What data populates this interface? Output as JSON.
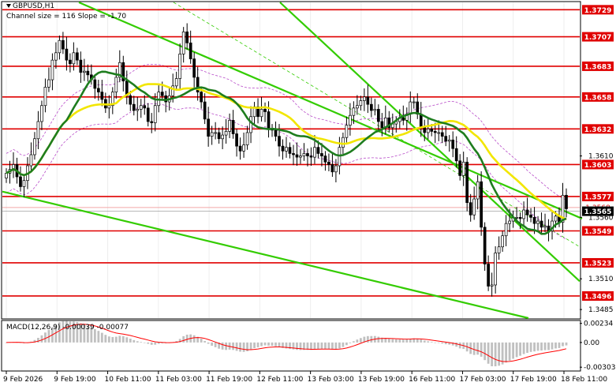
{
  "chart_data": [
    {
      "type": "candlestick",
      "title": "GBPUSD,H1",
      "subtitle": "Channel size = 116 Slope = -1.70",
      "y_ticks": [
        1.3729,
        1.3707,
        1.3683,
        1.3658,
        1.3632,
        1.361,
        1.3603,
        1.3577,
        1.3565,
        1.356,
        1.3549,
        1.3523,
        1.351,
        1.3496,
        1.3485
      ],
      "ylim": [
        1.3478,
        1.3735
      ],
      "levels": [
        {
          "value": 1.3729,
          "label": "1.3729"
        },
        {
          "value": 1.3707,
          "label": "1.3707"
        },
        {
          "value": 1.3683,
          "label": "1.3683"
        },
        {
          "value": 1.3658,
          "label": "1.3658"
        },
        {
          "value": 1.3632,
          "label": "1.3632"
        },
        {
          "value": 1.3603,
          "label": "1.3603"
        },
        {
          "value": 1.3577,
          "label": "1.3577"
        },
        {
          "value": 1.3549,
          "label": "1.3549"
        },
        {
          "value": 1.3523,
          "label": "1.3523"
        },
        {
          "value": 1.3496,
          "label": "1.3496"
        }
      ],
      "plain_ticks": [
        {
          "value": 1.361,
          "label": "1.3610"
        },
        {
          "value": 1.356,
          "label": "1.3560"
        },
        {
          "value": 1.351,
          "label": "1.3510"
        },
        {
          "value": 1.3485,
          "label": "1.3485"
        }
      ],
      "current_price": {
        "value": 1.3565,
        "label": "1.3565"
      },
      "prev_price": {
        "value": 1.3568,
        "label": "1.3568"
      },
      "level_color": "#e00000",
      "channel_color": "#33cc00",
      "ma_fast_color": "#1e7d1e",
      "ma_slow_color": "#f2e600",
      "envelope_color": "#b84cc9",
      "close": [
        1.3596,
        1.3599,
        1.3603,
        1.3593,
        1.3585,
        1.359,
        1.3602,
        1.3611,
        1.3624,
        1.3638,
        1.3651,
        1.3666,
        1.3672,
        1.3688,
        1.3694,
        1.3704,
        1.3697,
        1.3688,
        1.3685,
        1.3694,
        1.3688,
        1.3678,
        1.3679,
        1.3676,
        1.3672,
        1.3665,
        1.3662,
        1.3656,
        1.3649,
        1.3651,
        1.3662,
        1.3674,
        1.3686,
        1.3671,
        1.3659,
        1.3652,
        1.3647,
        1.3648,
        1.3651,
        1.3649,
        1.3638,
        1.3637,
        1.3651,
        1.3662,
        1.3659,
        1.3654,
        1.3659,
        1.3667,
        1.3673,
        1.3693,
        1.3711,
        1.3702,
        1.3689,
        1.3674,
        1.3662,
        1.3654,
        1.364,
        1.3626,
        1.3629,
        1.3629,
        1.3624,
        1.3627,
        1.363,
        1.3639,
        1.3628,
        1.3618,
        1.3614,
        1.3619,
        1.3629,
        1.3642,
        1.365,
        1.3642,
        1.3648,
        1.3646,
        1.3632,
        1.3631,
        1.3626,
        1.3618,
        1.3614,
        1.3617,
        1.3612,
        1.3611,
        1.3609,
        1.361,
        1.3612,
        1.361,
        1.3609,
        1.3617,
        1.3612,
        1.361,
        1.3605,
        1.3603,
        1.3597,
        1.3602,
        1.3617,
        1.3625,
        1.3635,
        1.3643,
        1.3649,
        1.3651,
        1.3655,
        1.3658,
        1.3652,
        1.3647,
        1.3648,
        1.3638,
        1.3633,
        1.3641,
        1.3633,
        1.3636,
        1.3638,
        1.3641,
        1.3639,
        1.3644,
        1.3654,
        1.3654,
        1.3644,
        1.3634,
        1.3629,
        1.3632,
        1.363,
        1.3629,
        1.3629,
        1.3626,
        1.3622,
        1.3623,
        1.3616,
        1.3606,
        1.3594,
        1.3605,
        1.3572,
        1.3562,
        1.3575,
        1.3589,
        1.3552,
        1.3522,
        1.3504,
        1.3505,
        1.3531,
        1.3536,
        1.3545,
        1.3555,
        1.3557,
        1.356,
        1.356,
        1.3559,
        1.3566,
        1.3562,
        1.356,
        1.3555,
        1.3557,
        1.3552,
        1.3553,
        1.3549,
        1.3557,
        1.3561,
        1.3556,
        1.3578,
        1.3567
      ]
    },
    {
      "type": "macd",
      "title": "MACD(12,26,9) -0.00039 -0.00077",
      "y_ticks": [
        0.00234,
        0.0,
        -0.00303
      ],
      "y_tick_labels": [
        "0.00234",
        "0.00",
        "-0.00303"
      ],
      "ylim": [
        -0.0034,
        0.0026
      ],
      "histogram_color": "#c0c0c0",
      "signal_color": "#ff0000"
    }
  ],
  "x_axis": {
    "labels": [
      "9 Feb 2026",
      "9 Feb 19:00",
      "10 Feb 11:00",
      "11 Feb 03:00",
      "11 Feb 19:00",
      "12 Feb 11:00",
      "13 Feb 03:00",
      "13 Feb 19:00",
      "16 Feb 11:00",
      "17 Feb 03:00",
      "17 Feb 19:00",
      "18 Feb 11:00"
    ]
  }
}
